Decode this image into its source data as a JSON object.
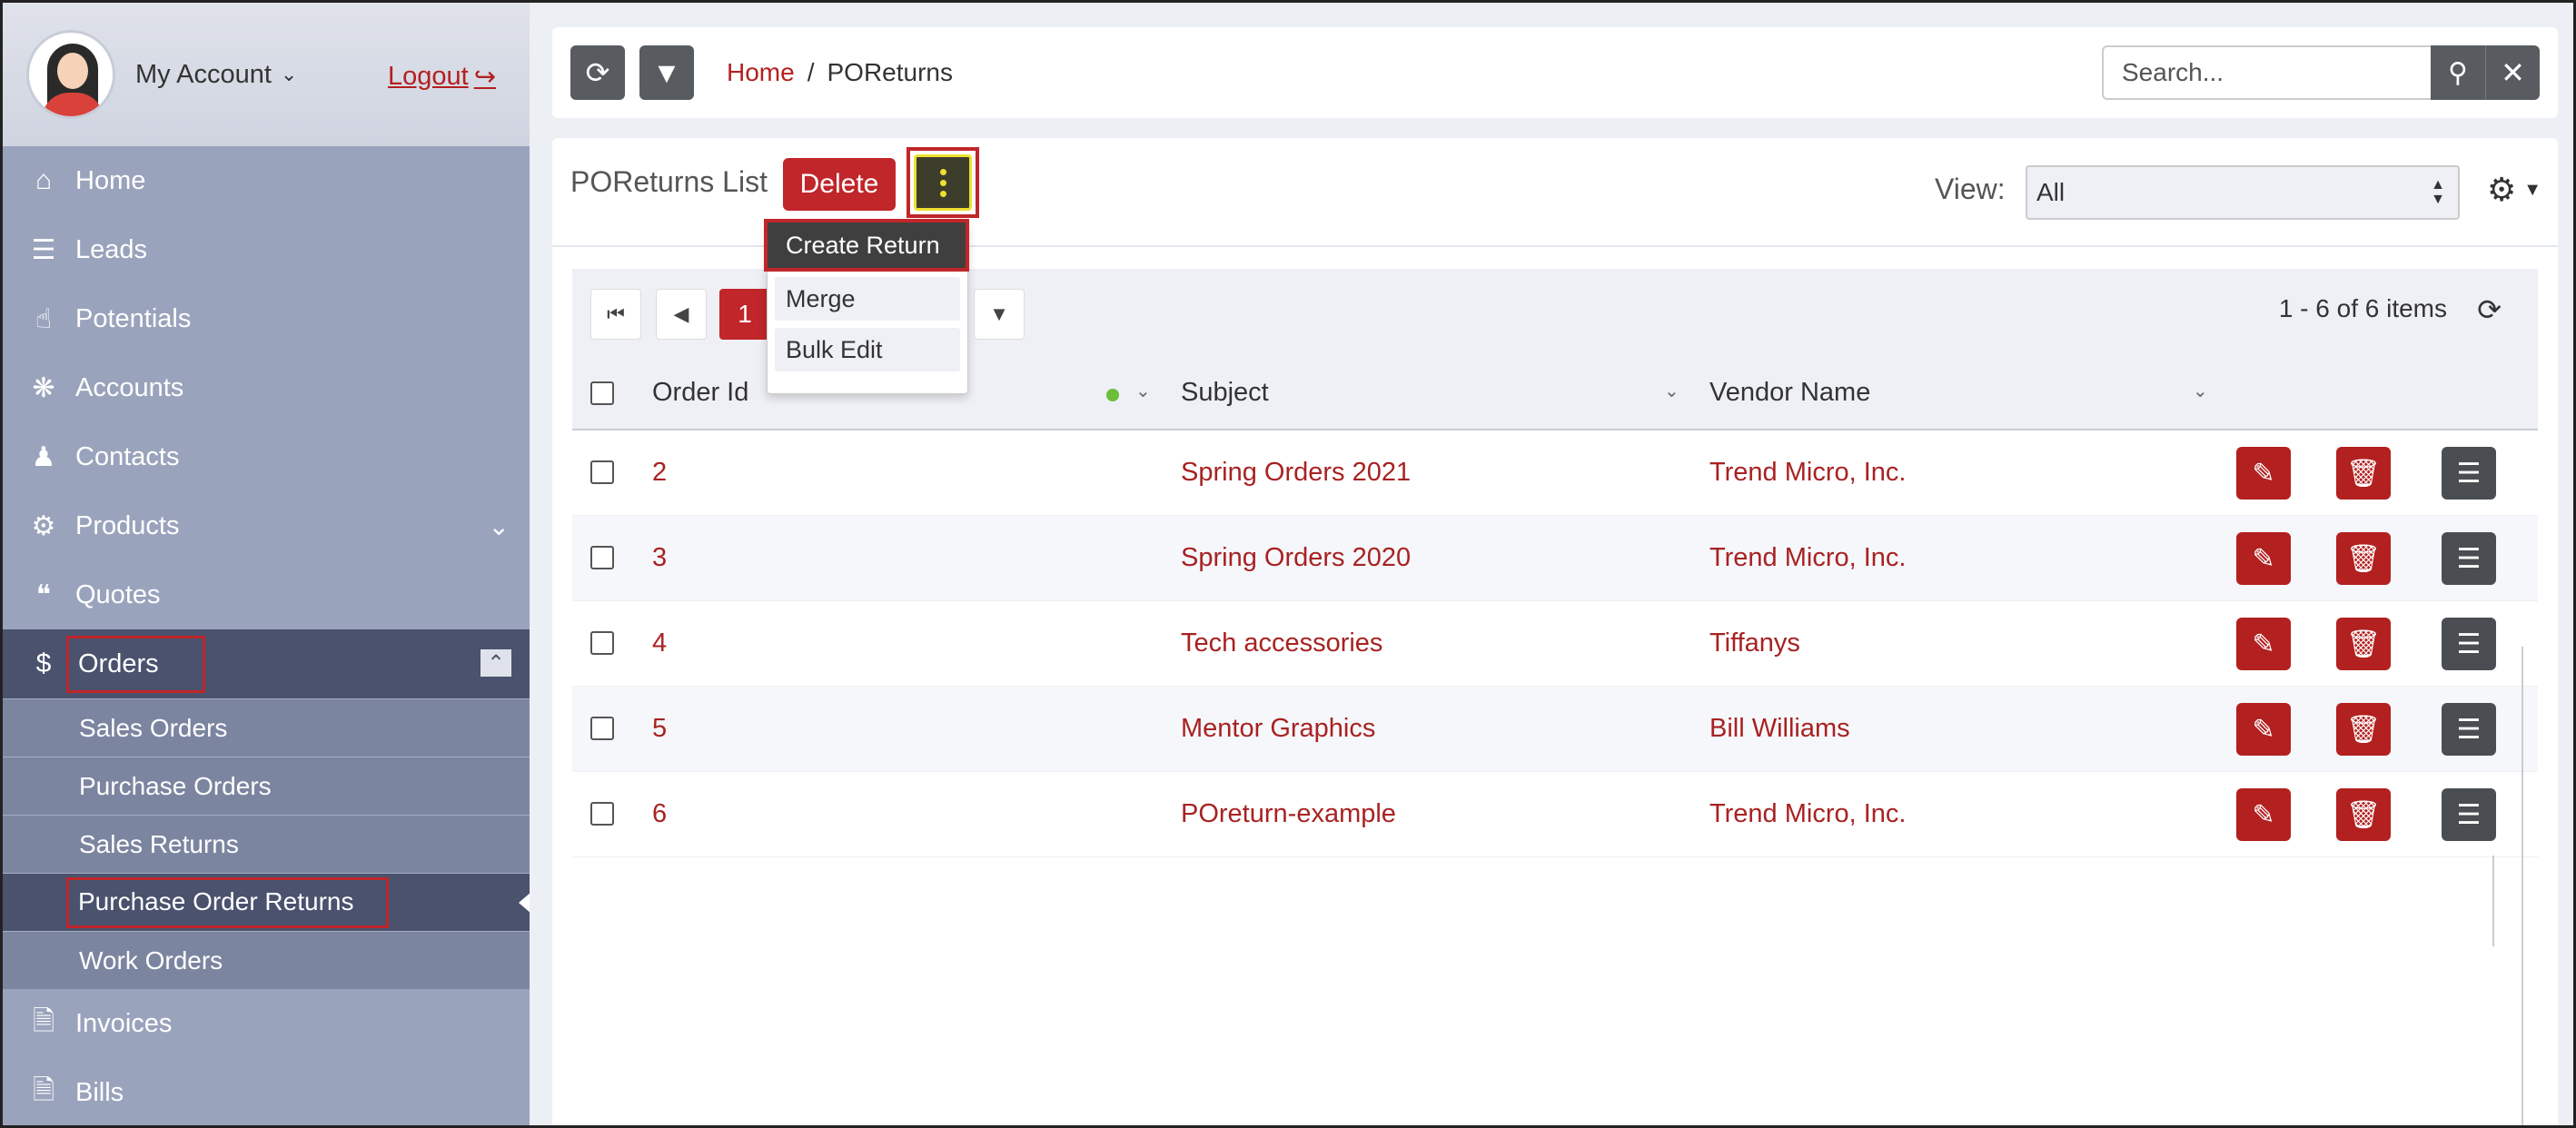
{
  "account": {
    "label": "My Account",
    "logout": "Logout"
  },
  "sidebar": {
    "items": [
      {
        "label": "Home",
        "icon": "home-icon"
      },
      {
        "label": "Leads",
        "icon": "leads-icon"
      },
      {
        "label": "Potentials",
        "icon": "thumbs-up-icon"
      },
      {
        "label": "Accounts",
        "icon": "paw-icon"
      },
      {
        "label": "Contacts",
        "icon": "user-icon"
      },
      {
        "label": "Products",
        "icon": "gears-icon"
      },
      {
        "label": "Quotes",
        "icon": "quote-icon"
      },
      {
        "label": "Orders",
        "icon": "dollar-icon"
      },
      {
        "label": "Invoices",
        "icon": "file-icon"
      },
      {
        "label": "Bills",
        "icon": "file-icon"
      }
    ],
    "orders_sub": [
      "Sales Orders",
      "Purchase Orders",
      "Sales Returns",
      "Purchase Order Returns",
      "Work Orders"
    ]
  },
  "breadcrumb": {
    "home": "Home",
    "separator": "/",
    "current": "POReturns"
  },
  "search": {
    "placeholder": "Search..."
  },
  "list": {
    "title": "POReturns List",
    "delete_label": "Delete",
    "more_menu": [
      "Create Return",
      "Merge",
      "Bulk Edit"
    ],
    "view_label": "View:",
    "view_value": "All"
  },
  "pager": {
    "current_page": "1",
    "info": "1 - 6 of 6 items"
  },
  "table": {
    "columns": [
      "Order Id",
      "Subject",
      "Vendor Name"
    ],
    "rows": [
      {
        "id": "2",
        "subject": "Spring Orders 2021",
        "vendor": "Trend Micro, Inc."
      },
      {
        "id": "3",
        "subject": "Spring Orders 2020",
        "vendor": "Trend Micro, Inc."
      },
      {
        "id": "4",
        "subject": "Tech accessories",
        "vendor": "Tiffanys"
      },
      {
        "id": "5",
        "subject": "Mentor Graphics",
        "vendor": "Bill Williams"
      },
      {
        "id": "6",
        "subject": "POreturn-example",
        "vendor": "Trend Micro, Inc."
      }
    ]
  },
  "colors": {
    "accent": "#c0262a",
    "sidebar": "#9aa3bc",
    "sidebar_active": "#4a526d"
  }
}
